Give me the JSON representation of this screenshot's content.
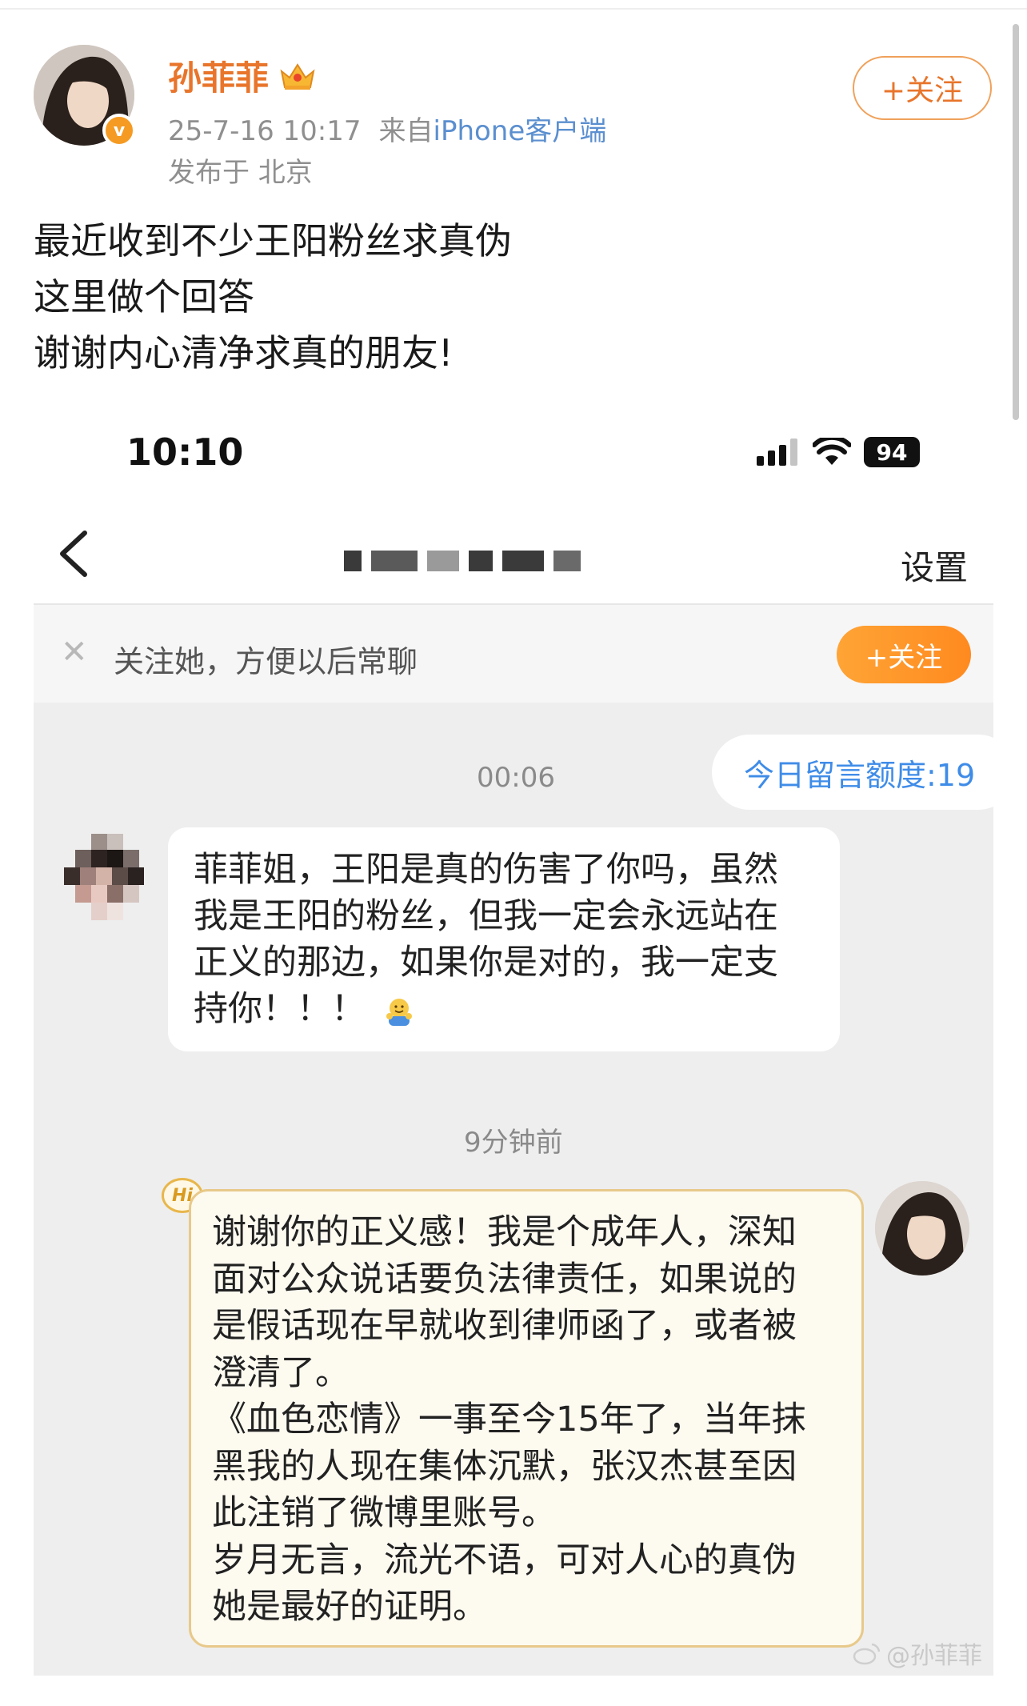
{
  "post": {
    "username": "孙菲菲",
    "timestamp": "25-7-16 10:17",
    "source_prefix": "来自",
    "source": "iPhone客户端",
    "location": "发布于 北京",
    "follow_label": "+关注",
    "lines": [
      "最近收到不少王阳粉丝求真伪",
      "这里做个回答",
      "谢谢内心清净求真的朋友!"
    ]
  },
  "phone": {
    "time": "10:10",
    "battery": "94"
  },
  "chat": {
    "settings_label": "设置",
    "follow_prompt": "关注她，方便以后常聊",
    "follow_button": "+关注",
    "quota": "今日留言额度:19",
    "time1": "00:06",
    "incoming_message": "菲菲姐，王阳是真的伤害了你吗，虽然我是王阳的粉丝，但我一定会永远站在正义的那边，如果你是对的，我一定支持你！！！",
    "time2": "9分钟前",
    "hi_badge": "Hi",
    "reply_paragraphs": [
      "谢谢你的正义感！我是个成年人，深知面对公众说话要负法律责任，如果说的是假话现在早就收到律师函了，或者被澄清了。",
      "《血色恋情》一事至今15年了，当年抹黑我的人现在集体沉默，张汉杰甚至因此注销了微博里账号。",
      "岁月无言，流光不语，可对人心的真伪她是最好的证明。"
    ]
  },
  "watermark": "@孙菲菲",
  "colors": {
    "username": "#e8752b",
    "link": "#5b8fcf",
    "quota_text": "#3f8ce8",
    "follow_gradient_start": "#ffa436",
    "follow_gradient_end": "#ff8a1f",
    "reply_bubble": "#fdfaf0",
    "reply_border": "#e8c98a"
  },
  "icons": [
    "crown-icon",
    "verified-badge-icon",
    "back-arrow-icon",
    "close-icon",
    "signal-icon",
    "wifi-icon",
    "battery-icon",
    "hug-emoji-icon",
    "weibo-logo-icon"
  ]
}
